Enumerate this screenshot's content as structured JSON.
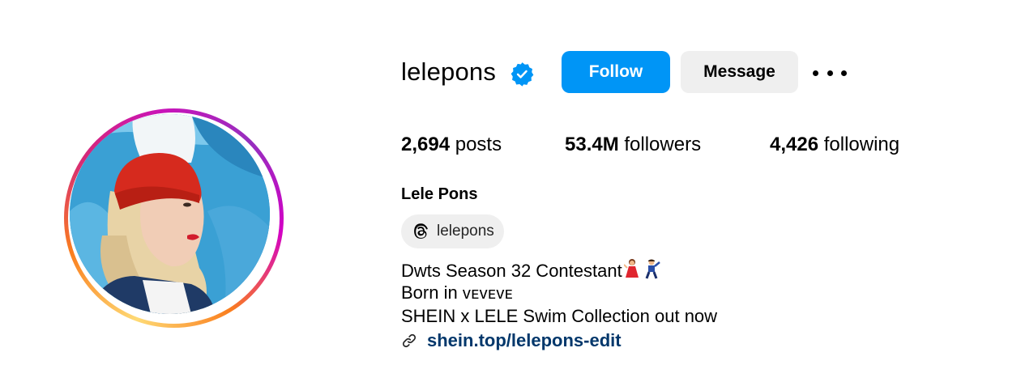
{
  "profile": {
    "username": "lelepons",
    "verified_icon": "verified-badge-icon",
    "full_name": "Lele Pons",
    "threads_handle": "lelepons",
    "avatar_alt": "profile picture"
  },
  "actions": {
    "follow_label": "Follow",
    "message_label": "Message",
    "more_icon": "more-options-icon"
  },
  "stats": {
    "posts_count": "2,694",
    "posts_label": "posts",
    "followers_count": "53.4M",
    "followers_label": "followers",
    "following_count": "4,426",
    "following_label": "following"
  },
  "bio": {
    "line1": "Dwts Season 32 Contestant",
    "line1_emoji": "💃🕺",
    "line2": "Born in 🇻🇪🇻🇪🇻🇪",
    "line2_text": "Born in ",
    "line2_flags": "ᴠᴇᴠᴇᴠᴇ",
    "line3": "SHEIN x LELE Swim Collection out now",
    "link": "shein.top/lelepons-edit"
  },
  "colors": {
    "accent": "#0095f6",
    "link": "#00376b",
    "button_secondary": "#efefef"
  }
}
